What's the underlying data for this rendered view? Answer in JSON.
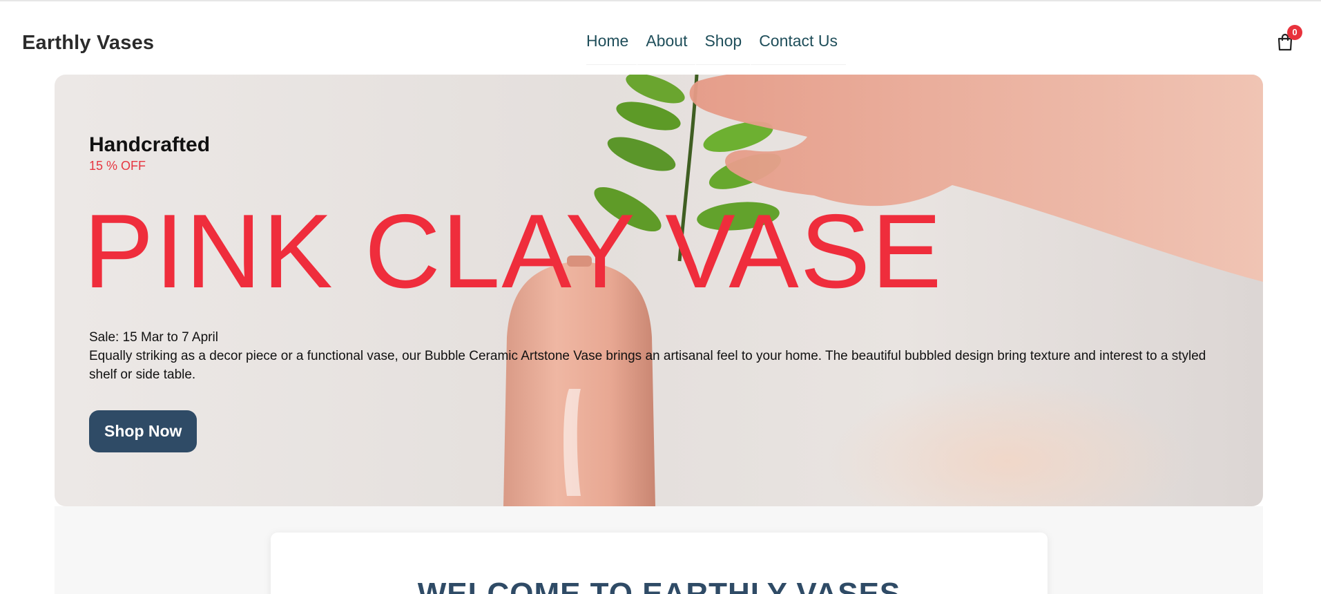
{
  "header": {
    "brand": "Earthly Vases",
    "nav": [
      "Home",
      "About",
      "Shop",
      "Contact Us"
    ],
    "cart_icon": "shopping-bag-icon",
    "cart_count": "0"
  },
  "hero": {
    "kicker": "Handcrafted",
    "discount": "15 % OFF",
    "headline": "PINK CLAY VASE",
    "sale_date": "Sale: 15 Mar to 7 April",
    "description": "Equally striking as a decor piece or a functional vase, our Bubble Ceramic Artstone Vase brings an artisanal feel to your home. The beautiful bubbled design bring texture and interest to a styled shelf or side table.",
    "cta": "Shop Now"
  },
  "welcome": {
    "title": "WELCOME TO EARTHLY VASES"
  },
  "colors": {
    "accent_red": "#ef2d3c",
    "button_navy": "#2f4b66",
    "nav_teal": "#1f4e5a"
  }
}
